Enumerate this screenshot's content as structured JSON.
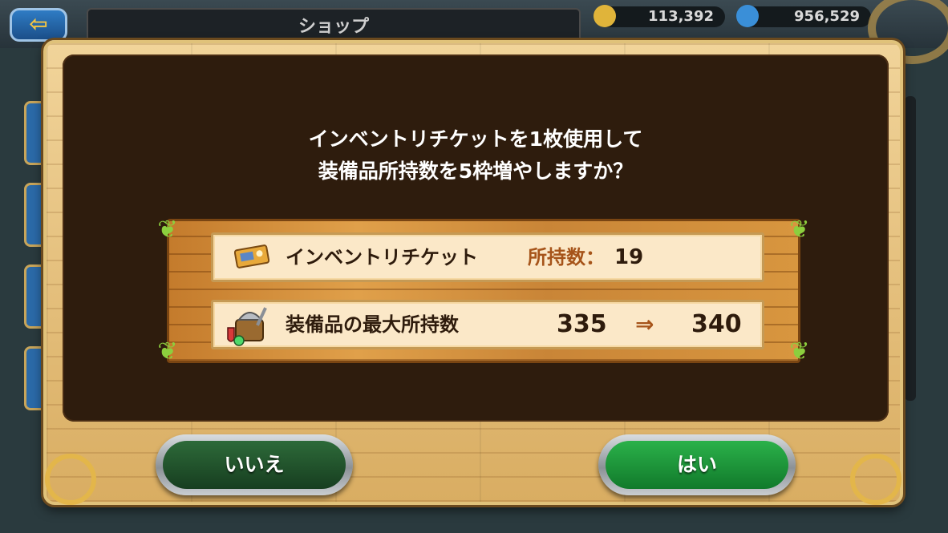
{
  "header": {
    "back_icon": "arrow-left-icon",
    "title": "ショップ",
    "currencies": [
      {
        "icon": "gold-coin-icon",
        "value": "113,392",
        "color": "#e0b43a"
      },
      {
        "icon": "blue-gem-icon",
        "value": "956,529",
        "color": "#3a8fd8"
      }
    ]
  },
  "dialog": {
    "message_line1": "インベントリチケットを1枚使用して",
    "message_line2": "装備品所持数を5枠増やしますか？",
    "ticket_row": {
      "icon": "ticket-icon",
      "label": "インベントリチケット",
      "owned_label": "所持数：",
      "owned_value": "19"
    },
    "capacity_row": {
      "icon": "equipment-icon",
      "label": "装備品の最大所持数",
      "from": "335",
      "arrow": "⇒",
      "to": "340"
    },
    "no_button": "いいえ",
    "yes_button": "はい"
  }
}
